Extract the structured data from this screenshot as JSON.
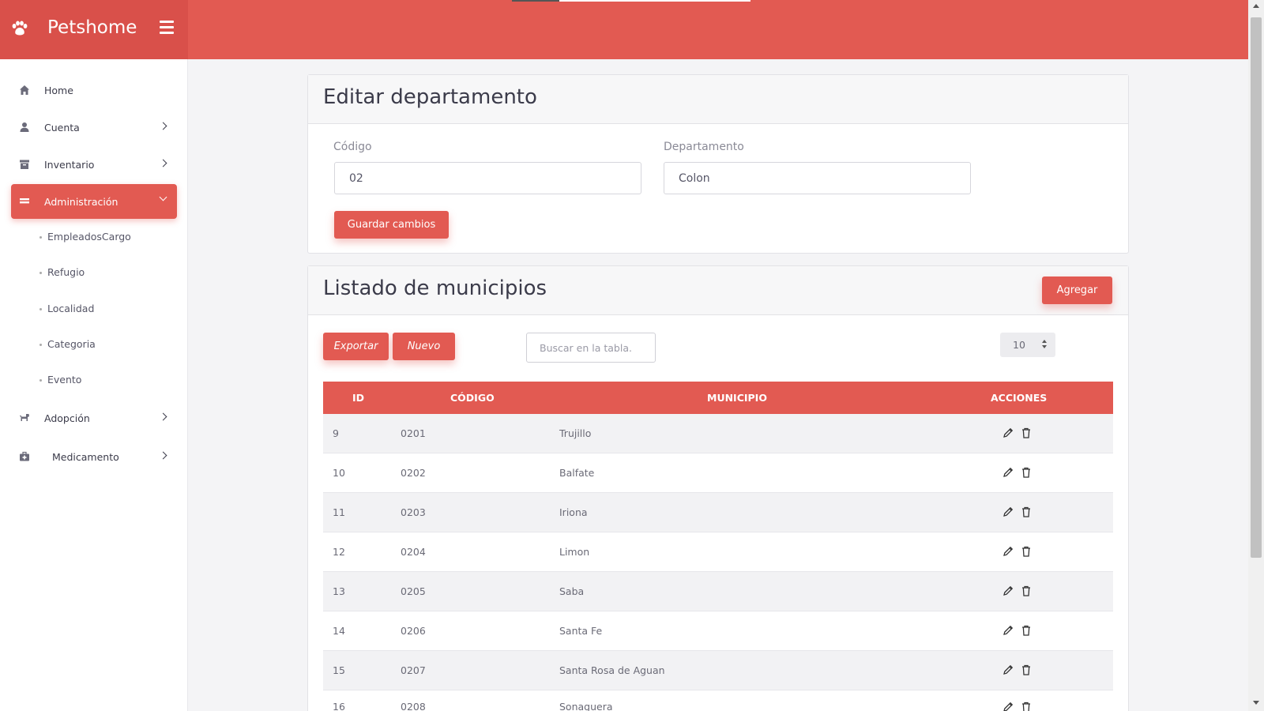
{
  "app": {
    "name": "Petshome"
  },
  "sidebar": {
    "items": [
      {
        "label": "Home",
        "icon": "home-icon",
        "active": false
      },
      {
        "label": "Cuenta",
        "icon": "user-icon",
        "active": false
      },
      {
        "label": "Inventario",
        "icon": "archive-icon",
        "active": false
      },
      {
        "label": "Administración",
        "icon": "list-icon",
        "active": true
      },
      {
        "label": "Adopción",
        "icon": "dog-icon",
        "active": false
      },
      {
        "label": "Medicamento",
        "icon": "medkit-icon",
        "active": false
      }
    ],
    "subitems": [
      "EmpleadosCargo",
      "Refugio",
      "Localidad",
      "Categoria",
      "Evento"
    ]
  },
  "edit_card": {
    "title": "Editar departamento",
    "codigo_label": "Código",
    "codigo_value": "02",
    "departamento_label": "Departamento",
    "departamento_value": "Colon",
    "save_label": "Guardar cambios"
  },
  "list_card": {
    "title": "Listado de municipios",
    "add_label": "Agregar",
    "export_label": "Exportar",
    "new_label": "Nuevo",
    "search_placeholder": "Buscar en la tabla.",
    "page_size": "10",
    "columns": [
      "ID",
      "CÓDIGO",
      "MUNICIPIO",
      "ACCIONES"
    ],
    "rows": [
      {
        "id": "9",
        "codigo": "0201",
        "municipio": "Trujillo"
      },
      {
        "id": "10",
        "codigo": "0202",
        "municipio": "Balfate"
      },
      {
        "id": "11",
        "codigo": "0203",
        "municipio": "Iriona"
      },
      {
        "id": "12",
        "codigo": "0204",
        "municipio": "Limon"
      },
      {
        "id": "13",
        "codigo": "0205",
        "municipio": "Saba"
      },
      {
        "id": "14",
        "codigo": "0206",
        "municipio": "Santa Fe"
      },
      {
        "id": "15",
        "codigo": "0207",
        "municipio": "Santa Rosa de Aguan"
      },
      {
        "id": "16",
        "codigo": "0208",
        "municipio": "Sonaguera"
      }
    ]
  },
  "colors": {
    "accent": "#e25a52",
    "accent_dark": "#d9504a",
    "sidebar_bg": "#ffffff",
    "page_bg": "#f4f4f6"
  }
}
